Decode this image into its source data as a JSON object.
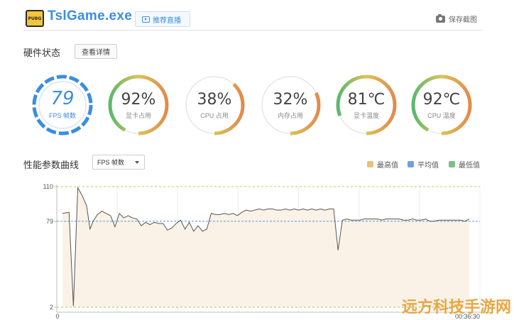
{
  "header": {
    "logo_text": "PUBG",
    "app_title": "TslGame.exe",
    "live_button": "推荐直播",
    "screenshot_button": "保存截图"
  },
  "hardware": {
    "title": "硬件状态",
    "detail_button": "查看详情",
    "gauges": [
      {
        "value": "79",
        "label": "FPS 帧数",
        "fill": 1.0,
        "kind": "fps"
      },
      {
        "value": "92%",
        "label": "显卡占用",
        "fill": 0.92,
        "kind": "pct"
      },
      {
        "value": "38%",
        "label": "CPU 占用",
        "fill": 0.38,
        "kind": "pct"
      },
      {
        "value": "32%",
        "label": "内存占用",
        "fill": 0.32,
        "kind": "pct"
      },
      {
        "value": "81℃",
        "label": "显卡温度",
        "fill": 0.81,
        "kind": "pct"
      },
      {
        "value": "92℃",
        "label": "CPU 温度",
        "fill": 0.92,
        "kind": "pct"
      }
    ]
  },
  "performance": {
    "title": "性能参数曲线",
    "select_value": "FPS 帧数",
    "legend": [
      {
        "label": "最高值",
        "color": "#e8c27a"
      },
      {
        "label": "平均值",
        "color": "#6aa2e8"
      },
      {
        "label": "最低值",
        "color": "#7cbf86"
      }
    ]
  },
  "chart_data": {
    "type": "area",
    "title": "",
    "xlabel": "",
    "ylabel": "",
    "y_ticks": [
      "110",
      "79",
      "2"
    ],
    "x_tick_labels": [
      "0",
      "00:36:30"
    ],
    "ylim": [
      2,
      110
    ],
    "max_line": 110,
    "avg_line": 79,
    "min_line": 2,
    "colors": {
      "line": "#555555",
      "fill": "#faf2e6",
      "max": "#b9cc5a",
      "avg": "#6aa2e8",
      "min": "#9ccf6a"
    },
    "x": [
      0,
      1.5,
      2.5,
      3.5,
      4.5,
      5.5,
      6.3,
      7,
      8,
      9,
      10,
      11,
      12,
      13,
      14,
      15,
      16,
      17,
      18,
      19,
      20,
      21,
      22,
      23,
      24,
      25,
      26,
      27,
      28,
      29,
      30,
      31,
      32,
      33,
      34,
      35,
      36,
      37,
      38,
      39,
      40,
      41,
      42,
      43,
      44,
      45,
      46,
      47,
      48,
      49,
      50,
      51,
      52,
      53,
      54,
      55,
      56,
      57,
      58,
      59,
      60,
      61,
      62,
      63,
      64,
      65,
      66,
      67,
      68,
      69,
      70,
      71,
      72,
      73,
      74,
      75,
      76,
      77,
      78,
      79,
      80,
      81,
      82,
      83,
      84,
      85,
      86,
      87,
      88,
      89,
      90,
      91,
      92,
      93
    ],
    "values": [
      86,
      87,
      3,
      109,
      102,
      93,
      72,
      79,
      85,
      88,
      86,
      84,
      74,
      86,
      82,
      84,
      82,
      81,
      75,
      78,
      76,
      78,
      77,
      77,
      71,
      73,
      77,
      80,
      72,
      78,
      70,
      75,
      70,
      72,
      86,
      85,
      85,
      86,
      85,
      86,
      84,
      87,
      89,
      88,
      89,
      90,
      89,
      90,
      90,
      89,
      89,
      90,
      89,
      90,
      89,
      90,
      89,
      90,
      89,
      90,
      89,
      90,
      90,
      53,
      80,
      81,
      80,
      80,
      80,
      81,
      81,
      81,
      81,
      80,
      81,
      81,
      81,
      81,
      80,
      80,
      81,
      80,
      80,
      81,
      79,
      79,
      80,
      80,
      80,
      80,
      80,
      80,
      79,
      81
    ]
  },
  "watermark": "远方科技手游网"
}
